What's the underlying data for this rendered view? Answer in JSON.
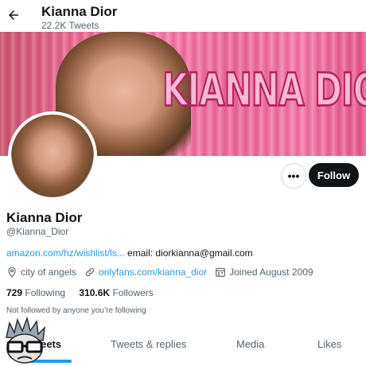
{
  "header": {
    "title": "Kianna Dior",
    "subtitle": "22.2K Tweets"
  },
  "banner": {
    "wordmark": "KIANNA DIOR"
  },
  "actions": {
    "more_label": "•••",
    "follow_label": "Follow"
  },
  "profile": {
    "name": "Kianna Dior",
    "handle": "@Kianna_Dior",
    "bio_link": "amazon.com/hz/wishlist/ls...",
    "bio_text": " email: diorkianna@gmail.com",
    "location": "city of angels",
    "website": "onlyfans.com/kianna_dior",
    "joined": "Joined August 2009",
    "following_count": "729",
    "following_label": " Following",
    "followers_count": "310.6K",
    "followers_label": " Followers",
    "not_followed_note": "Not followed by anyone you’re following"
  },
  "tabs": [
    {
      "label": "Tweets"
    },
    {
      "label": "Tweets & replies"
    },
    {
      "label": "Media"
    },
    {
      "label": "Likes"
    }
  ],
  "icons": [
    "back-arrow-icon",
    "location-pin-icon",
    "link-icon",
    "calendar-icon",
    "mascot-logo"
  ],
  "colors": {
    "accent": "#1d9bf0",
    "text": "#0f1419",
    "muted": "#536471",
    "follow_bg": "#0f1419"
  }
}
